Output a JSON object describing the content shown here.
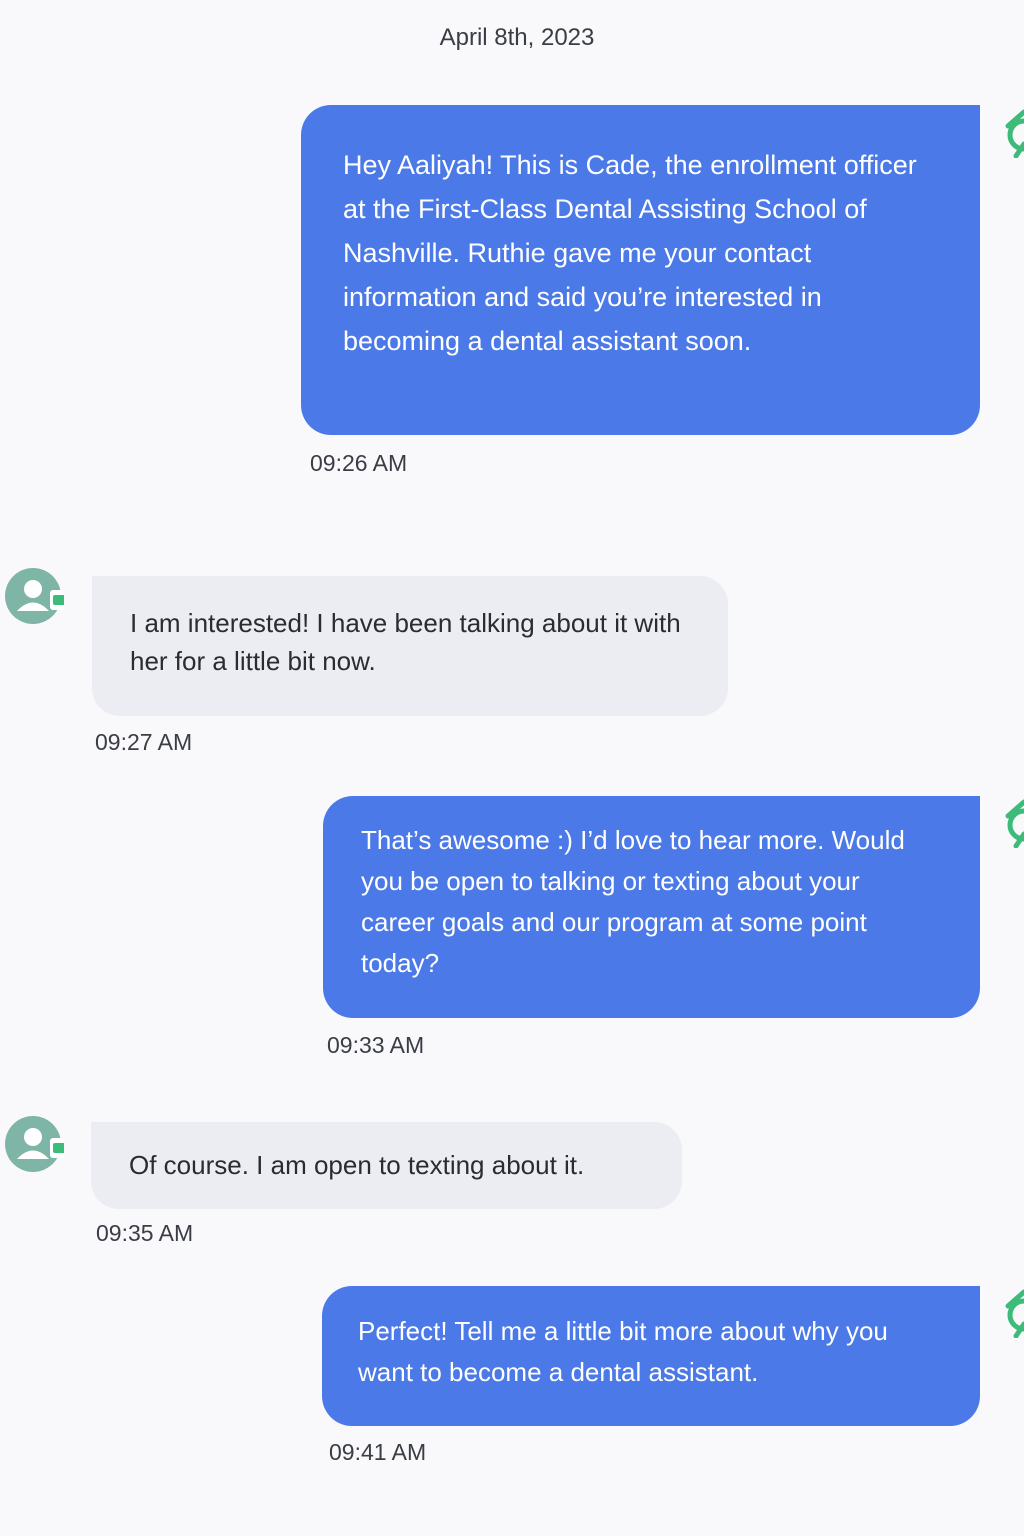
{
  "conversation": {
    "date": "April 8th, 2023",
    "messages": [
      {
        "direction": "outgoing",
        "text": "Hey Aaliyah! This is Cade, the enrollment officer at the First-Class Dental Assisting School of Nashville. Ruthie gave me your contact information and said you’re interested in becoming a dental assistant soon.",
        "time": "09:26 AM"
      },
      {
        "direction": "incoming",
        "text": "I am interested! I have been talking about it with her for a little bit now.",
        "time": "09:27 AM"
      },
      {
        "direction": "outgoing",
        "text": "That’s awesome :) I’d love to hear more. Would you be open to talking or texting about your career goals and our program at some point today?",
        "time": "09:33 AM"
      },
      {
        "direction": "incoming",
        "text": "Of course. I am open to texting about it.",
        "time": "09:35 AM"
      },
      {
        "direction": "outgoing",
        "text": "Perfect! Tell me a little bit more about why you want to become a dental assistant.",
        "time": "09:41 AM"
      }
    ]
  },
  "icons": {
    "contact_avatar": "contact-avatar-icon",
    "sender_edge": "sender-status-icon"
  },
  "colors": {
    "outgoing_bubble": "#4b79e8",
    "incoming_bubble": "#ecedf2",
    "avatar_teal": "#7fb5a6",
    "badge_green": "#3dbb79"
  }
}
